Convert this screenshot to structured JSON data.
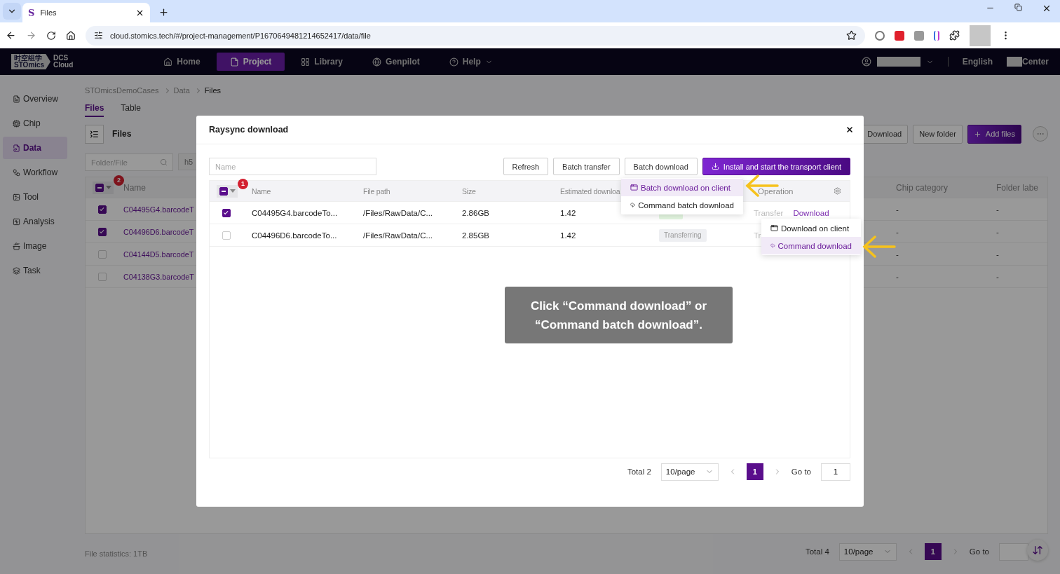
{
  "browser": {
    "favicon": "S",
    "tab_title": "Files",
    "url": "cloud.stomics.tech/#/project-management/P1670649481214652417/data/file"
  },
  "header": {
    "logo": {
      "cn": "时空组学",
      "en": "STOmics",
      "product_1": "DCS",
      "product_2": "Cloud"
    },
    "nav": [
      {
        "label": "Home",
        "selected": false
      },
      {
        "label": "Project",
        "selected": true
      },
      {
        "label": "Library",
        "selected": false
      },
      {
        "label": "Genpilot",
        "selected": false
      },
      {
        "label": "Help",
        "selected": false
      }
    ],
    "language": "English",
    "center": "Center"
  },
  "sidebar": {
    "items": [
      {
        "label": "Overview",
        "selected": false
      },
      {
        "label": "Chip",
        "selected": false
      },
      {
        "label": "Data",
        "selected": true
      },
      {
        "label": "Workflow",
        "selected": false
      },
      {
        "label": "Tool",
        "selected": false
      },
      {
        "label": "Analysis",
        "selected": false
      },
      {
        "label": "Image",
        "selected": false
      },
      {
        "label": "Task",
        "selected": false
      }
    ]
  },
  "page": {
    "breadcrumb": [
      "STOmicsDemoCases",
      "Data",
      "Files"
    ],
    "tabs": [
      {
        "label": "Files",
        "selected": true
      },
      {
        "label": "Table",
        "selected": false
      }
    ],
    "toolbar_title": "Files",
    "buttons": [
      {
        "label": "Download",
        "kind": "default"
      },
      {
        "label": "New folder",
        "kind": "default"
      },
      {
        "label": "Add files",
        "kind": "primary"
      }
    ],
    "search": {
      "placeholder": "Folder/File"
    },
    "filter": {
      "value": "h5"
    },
    "table": {
      "select_all_indeterminate": true,
      "selection_count": "2",
      "columns": [
        "Name",
        "Chip category",
        "Folder labe"
      ],
      "rows": [
        {
          "name": "C04495G4.barcodeT",
          "checked": true,
          "chip_category": "-",
          "folder_label": "-"
        },
        {
          "name": "C04496D6.barcodeT",
          "checked": true,
          "chip_category": "-",
          "folder_label": "-"
        },
        {
          "name": "C04144D5.barcodeT",
          "checked": false,
          "chip_category": "-",
          "folder_label": "-"
        },
        {
          "name": "C04138G3.barcodeT",
          "checked": false,
          "chip_category": "-",
          "folder_label": "-"
        }
      ]
    },
    "file_statistics": "File statistics: 1TB",
    "pagination": {
      "total": "Total 4",
      "page_size": "10/page",
      "pages": [
        {
          "label": "1",
          "selected": true
        }
      ],
      "goto": "Go to"
    }
  },
  "modal": {
    "title": "Raysync download",
    "search": {
      "placeholder": "Name"
    },
    "buttons": [
      {
        "label": "Refresh",
        "kind": "default"
      },
      {
        "label": "Batch transfer",
        "kind": "default"
      },
      {
        "label": "Batch download",
        "kind": "default"
      },
      {
        "label": "Install and start the transport client",
        "kind": "primary"
      }
    ],
    "table": {
      "select_all_indeterminate": true,
      "selection_count": "1",
      "columns": [
        "Name",
        "File path",
        "Size",
        "Estimated downloa",
        "Operation"
      ],
      "rows": [
        {
          "checked": true,
          "name": "C04495G4.barcodeTo...",
          "path": "/Files/RawData/C...",
          "size": "2.86GB",
          "estimate": "1.42",
          "status": {
            "kind": "done"
          },
          "operations": [
            {
              "label": "Transfer",
              "disabled": true
            },
            {
              "label": "Download",
              "disabled": false
            }
          ]
        },
        {
          "checked": false,
          "name": "C04496D6.barcodeTo...",
          "path": "/Files/RawData/C...",
          "size": "2.85GB",
          "estimate": "1.42",
          "status": {
            "kind": "transferring",
            "label": "Transferring"
          },
          "operations": [
            {
              "label": "Tr",
              "disabled": true
            }
          ]
        }
      ]
    },
    "pagination": {
      "total": "Total 2",
      "page_size": "10/page",
      "pages": [
        {
          "label": "1",
          "selected": true
        }
      ],
      "goto": "Go to",
      "goto_value": "1"
    },
    "batch_menu": [
      {
        "label": "Batch download on client",
        "selected": true
      },
      {
        "label": "Command batch download",
        "selected": false
      }
    ],
    "row_menu": [
      {
        "label": "Download on client",
        "selected": false
      },
      {
        "label": "Command download",
        "selected": true
      }
    ]
  },
  "tooltip": "Click “Command download” or “Command batch download”."
}
